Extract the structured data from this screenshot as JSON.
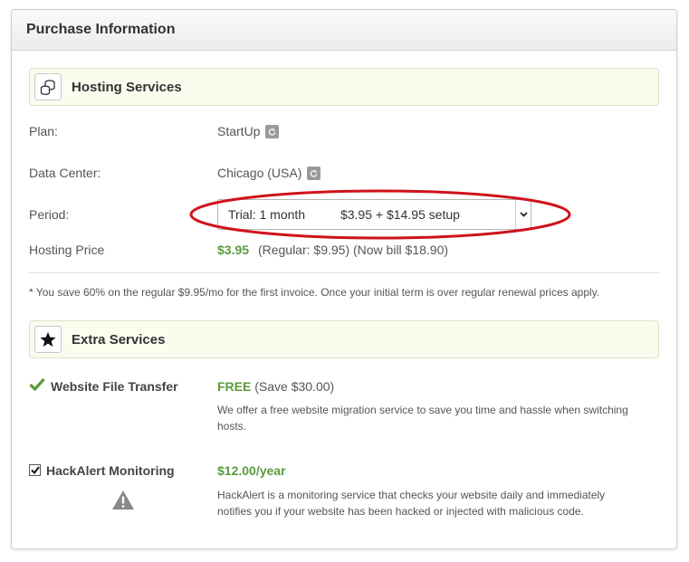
{
  "panel": {
    "title": "Purchase Information"
  },
  "hosting": {
    "section_title": "Hosting Services",
    "section_icon": "coins-stack-icon",
    "plan_label": "Plan:",
    "plan_value": "StartUp",
    "datacenter_label": "Data Center:",
    "datacenter_value": "Chicago (USA)",
    "period_label": "Period:",
    "period_selected": "Trial: 1 month          $3.95 + $14.95 setup",
    "price_label": "Hosting Price",
    "price_value": "$3.95",
    "price_detail": "(Regular: $9.95) (Now bill $18.90)",
    "note": "* You save 60% on the regular $9.95/mo for the first invoice. Once your initial term is over regular renewal prices apply."
  },
  "extras": {
    "section_title": "Extra Services",
    "section_icon": "star-icon",
    "items": [
      {
        "name": "Website File Transfer",
        "icon": "checkmark-icon",
        "price": "FREE",
        "price_note": "(Save $30.00)",
        "desc_line1": "We offer a free website migration service to save you time and hassle when switching",
        "desc_line2": "hosts."
      },
      {
        "name": "HackAlert Monitoring",
        "icon": "checkbox-checked-icon",
        "price": "$12.00/year",
        "desc_line1": "HackAlert is a monitoring service that checks your website daily and immediately",
        "desc_line2": "notifies you if your website has been hacked or injected with malicious code."
      }
    ]
  },
  "colors": {
    "accent_green": "#5a9a3d",
    "highlight_red": "#d0121b",
    "section_bg": "#fbfbee"
  }
}
